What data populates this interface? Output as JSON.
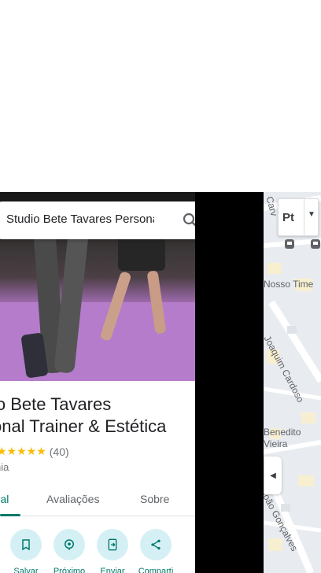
{
  "search": {
    "query": "Studio Bete Tavares Personal Trainer & Estética"
  },
  "place": {
    "title_line1": "io Bete Tavares",
    "title_line2": "onal Trainer & Estética",
    "stars": "★★★★★",
    "review_count": "(40)",
    "category": "nia"
  },
  "tabs": [
    {
      "label": "eral",
      "active": true
    },
    {
      "label": "Avaliações",
      "active": false
    },
    {
      "label": "Sobre",
      "active": false
    }
  ],
  "actions": [
    {
      "label": "Salvar",
      "icon": "bookmark-icon"
    },
    {
      "label": "Próximo",
      "icon": "nearby-icon"
    },
    {
      "label": "Enviar",
      "icon": "send-to-phone-icon"
    },
    {
      "label": "Comparti",
      "icon": "share-icon"
    }
  ],
  "map": {
    "layer_label": "Pt",
    "labels": {
      "street_top": "Carv",
      "nosso_time": "Nosso Time",
      "joaquim": "Joaquim Cardoso",
      "benedito": "Benedito\nVieira",
      "goncalves": "João Gonçalves"
    }
  },
  "colors": {
    "accent": "#00796b",
    "star": "#fbbc04",
    "action_bg": "#d4f0f5"
  }
}
